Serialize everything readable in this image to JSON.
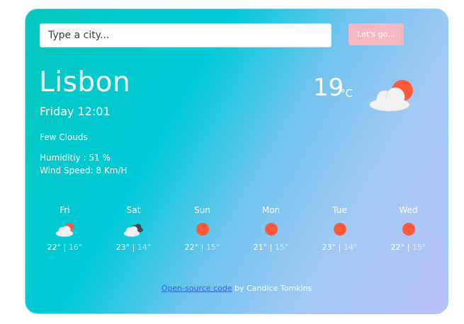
{
  "search": {
    "placeholder": "Type a city...",
    "value": "",
    "button_label": "Let's go..."
  },
  "current": {
    "city": "Lisbon",
    "datetime": "Friday 12:01",
    "description": "Few Clouds",
    "humidity": "Humiditiy : 51 %",
    "wind": "Wind Speed: 8 Km/H",
    "temperature": "19",
    "unit": "°C",
    "icon": "sun-behind-cloud-icon"
  },
  "forecast": [
    {
      "day": "Fri",
      "max": "22°",
      "min": "16°",
      "icon": "sun-behind-cloud-icon"
    },
    {
      "day": "Sat",
      "max": "23°",
      "min": "14°",
      "icon": "broken-clouds-icon"
    },
    {
      "day": "Sun",
      "max": "22°",
      "min": "15°",
      "icon": "sun-icon"
    },
    {
      "day": "Mon",
      "max": "21°",
      "min": "15°",
      "icon": "sun-icon"
    },
    {
      "day": "Tue",
      "max": "23°",
      "min": "14°",
      "icon": "sun-icon"
    },
    {
      "day": "Wed",
      "max": "22°",
      "min": "15°",
      "icon": "sun-icon"
    }
  ],
  "footer": {
    "link_text": "Open-source code",
    "credit": " by Candice Tomkins"
  },
  "colors": {
    "sun": "#ff5a3c",
    "button": "#f7b7c1",
    "link": "#2a62e8"
  }
}
